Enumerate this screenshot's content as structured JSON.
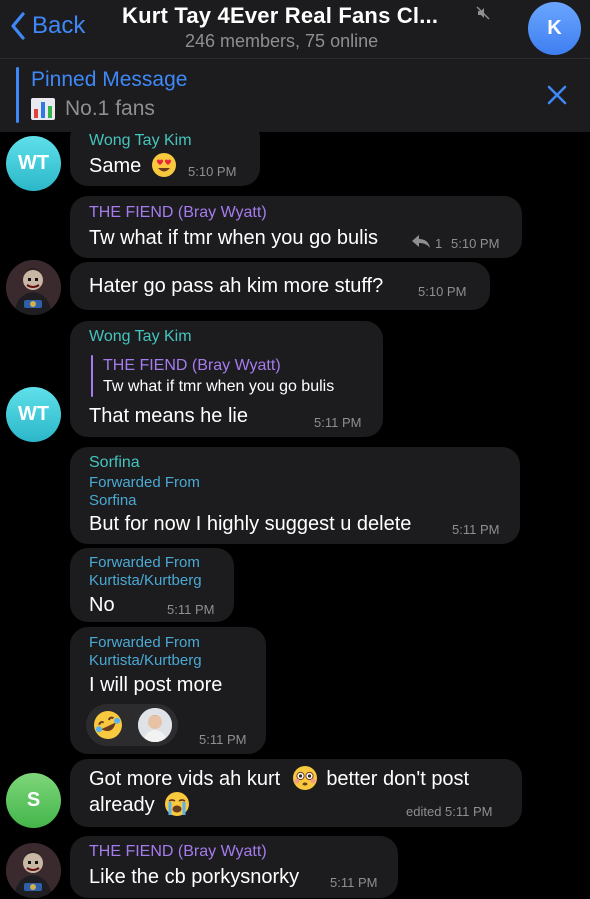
{
  "header": {
    "back_label": "Back",
    "title": "Kurt Tay 4Ever Real Fans Cl...",
    "subtitle": "246 members, 75 online",
    "avatar_letter": "K",
    "accent": "#3e88f7"
  },
  "pinned": {
    "title": "Pinned Message",
    "text": "No.1 fans",
    "icon": "bar-chart-icon"
  },
  "messages": [
    {
      "sender": "Wong Tay Kim",
      "text": "Same",
      "emoji": "heart-eyes",
      "time": "5:10 PM",
      "avatar": "WT"
    },
    {
      "sender": "THE FIEND (Bray Wyatt)",
      "text": "Tw what if tmr when you go bulis",
      "reply_count": "1",
      "time": "5:10 PM"
    },
    {
      "text": "Hater go pass ah kim more stuff?",
      "time": "5:10 PM",
      "avatar": "fiend-photo"
    },
    {
      "sender": "Wong Tay Kim",
      "reply_to": {
        "sender": "THE FIEND (Bray Wyatt)",
        "text": "Tw what if tmr when you go bulis"
      },
      "text": "That means he lie",
      "time": "5:11 PM",
      "avatar": "WT"
    },
    {
      "sender": "Sorfina",
      "forwarded_label": "Forwarded From",
      "forwarded_from": "Sorfina",
      "text": "But for now I highly suggest u delete",
      "time": "5:11 PM"
    },
    {
      "forwarded_label": "Forwarded From",
      "forwarded_from": "Kurtista/Kurtberg",
      "text": "No",
      "time": "5:11 PM"
    },
    {
      "forwarded_label": "Forwarded From",
      "forwarded_from": "Kurtista/Kurtberg",
      "text": "I will post more",
      "time": "5:11 PM",
      "reactions": [
        "rofl",
        "user-avatar"
      ]
    },
    {
      "text_line1": "Got more vids ah kurt",
      "text_line1b": "better don't post",
      "text_line2": "already",
      "time": "edited 5:11 PM",
      "avatar": "S"
    },
    {
      "sender": "THE FIEND (Bray Wyatt)",
      "text": "Like the cb porkysnorky",
      "time": "5:11 PM",
      "avatar": "fiend-photo"
    }
  ],
  "colors": {
    "background": "#000000",
    "bubble": "#1c1c1e",
    "teal_name": "#45c4be",
    "purple_name": "#a57bee",
    "forward": "#4aa9d4",
    "time": "#8e8e93"
  }
}
